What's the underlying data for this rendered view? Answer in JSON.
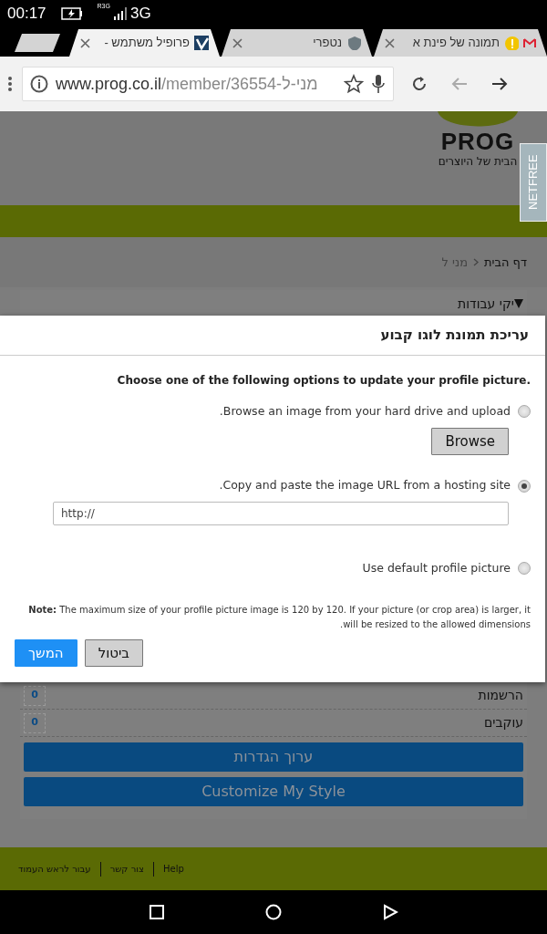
{
  "status_bar": {
    "time": "00:17",
    "network": "3G",
    "roaming": "R3G"
  },
  "browser": {
    "tabs": [
      {
        "title": "תמונה של פינת א",
        "selected": false
      },
      {
        "title": "נטפרי",
        "selected": false
      },
      {
        "title": "פרופיל משתמש -",
        "selected": true
      }
    ],
    "url": {
      "domain": "www.prog.co.il",
      "path": "/member/36554-מני-ל"
    }
  },
  "site": {
    "logo": {
      "name": "PROG",
      "tagline": "הבית של היוצרים"
    },
    "extension_badge": "NETFREE",
    "breadcrumb": [
      {
        "label": "דף הבית",
        "current": false
      },
      {
        "label": "מני ל",
        "current": true
      }
    ],
    "panel_heading": "יקי עבודות",
    "stats": [
      {
        "label": "הרשמות",
        "count": "0"
      },
      {
        "label": "עוקבים",
        "count": "0"
      }
    ],
    "buttons": [
      "ערוך הגדרות",
      "Customize My Style"
    ],
    "footer_links": [
      "Help",
      "צור קשר",
      "עבור לראש העמוד"
    ]
  },
  "dialog": {
    "title": "עריכת תמונת לוגו קבוע",
    "instruction": "Choose one of the following options to update your profile picture.",
    "options": [
      {
        "kind": "upload",
        "label": "Browse an image from your hard drive and upload.",
        "selected": false,
        "button": "Browse"
      },
      {
        "kind": "url",
        "label": "Copy and paste the image URL from a hosting site.",
        "selected": true,
        "value": "http://"
      },
      {
        "kind": "default",
        "label": "Use default profile picture",
        "selected": false
      }
    ],
    "note": "**Note:** The maximum size of your profile picture image is 120 by 120. If your picture (or crop area) is larger, it will be resized to the allowed dimensions.",
    "buttons": [
      {
        "label": "ביטול",
        "kind": "secondary"
      },
      {
        "label": "המשך",
        "kind": "primary"
      }
    ]
  }
}
